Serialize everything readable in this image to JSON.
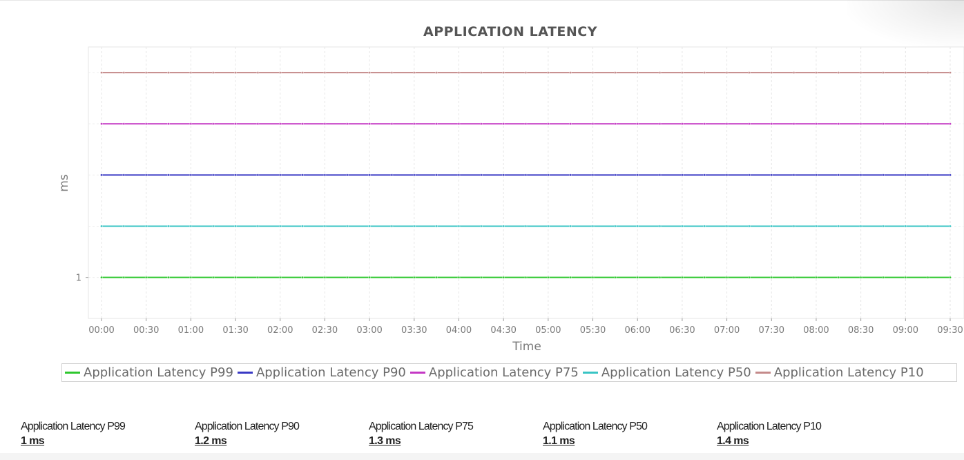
{
  "chart_data": {
    "type": "line",
    "title": "APPLICATION LATENCY",
    "xlabel": "Time",
    "ylabel": "ms",
    "x_ticks": [
      "00:00",
      "00:30",
      "01:00",
      "01:30",
      "02:00",
      "02:30",
      "03:00",
      "03:30",
      "04:00",
      "04:30",
      "05:00",
      "05:30",
      "06:00",
      "06:30",
      "07:00",
      "07:30",
      "08:00",
      "08:30",
      "09:00",
      "09:30"
    ],
    "y_ticks": [
      "1"
    ],
    "x_range_minutes": [
      0,
      570
    ],
    "points_x_minutes": [
      0,
      15,
      30,
      45,
      60,
      75,
      90,
      105,
      120,
      135,
      150,
      165,
      180,
      195,
      210,
      225,
      240,
      255,
      270,
      285,
      300,
      315,
      330,
      345,
      360,
      375,
      390,
      405,
      420,
      435,
      450,
      465,
      480,
      495,
      510,
      525,
      540,
      555,
      570
    ],
    "ylim": [
      0.92,
      1.45
    ],
    "grid": true,
    "legend_position": "bottom",
    "series": [
      {
        "name": "Application Latency P99",
        "color": "#2ec72e",
        "value": 1.0
      },
      {
        "name": "Application Latency P90",
        "color": "#3939c4",
        "value": 1.2
      },
      {
        "name": "Application Latency P75",
        "color": "#c438c4",
        "value": 1.3
      },
      {
        "name": "Application Latency P50",
        "color": "#38c4c4",
        "value": 1.1
      },
      {
        "name": "Application Latency P10",
        "color": "#c48a8a",
        "value": 1.4
      }
    ]
  },
  "summary": [
    {
      "label": "Application Latency P99",
      "value": "1 ms"
    },
    {
      "label": "Application Latency P90",
      "value": "1.2 ms"
    },
    {
      "label": "Application Latency P75",
      "value": "1.3 ms"
    },
    {
      "label": "Application Latency P50",
      "value": "1.1 ms"
    },
    {
      "label": "Application Latency P10",
      "value": "1.4 ms"
    }
  ]
}
